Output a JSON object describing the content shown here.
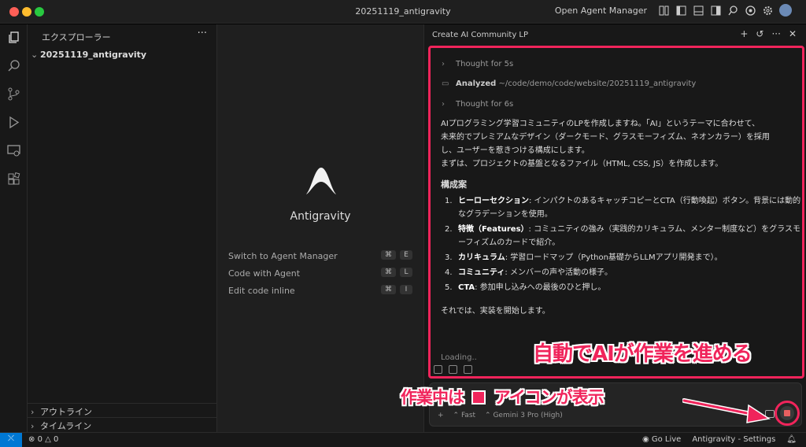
{
  "window": {
    "title": "20251119_antigravity",
    "agent_manager_label": "Open Agent Manager"
  },
  "explorer": {
    "title": "エクスプローラー",
    "more": "···",
    "folder": "20251119_antigravity",
    "outline": "アウトライン",
    "timeline": "タイムライン"
  },
  "editor": {
    "app_name": "Antigravity",
    "shortcuts": [
      {
        "label": "Switch to Agent Manager",
        "key1": "⌘",
        "key2": "E"
      },
      {
        "label": "Code with Agent",
        "key1": "⌘",
        "key2": "L"
      },
      {
        "label": "Edit code inline",
        "key1": "⌘",
        "key2": "I"
      }
    ]
  },
  "chat": {
    "title": "Create AI Community LP",
    "thought1": "Thought for 5s",
    "analyzed_label": "Analyzed",
    "analyzed_path": "~/code/demo/code/website/20251119_antigravity",
    "thought2": "Thought for 6s",
    "intro_lines": [
      "AIプログラミング学習コミュニティのLPを作成しますね。「AI」というテーマに合わせて、",
      "未来的でプレミアムなデザイン（ダークモード、グラスモーフィズム、ネオンカラー）を採用",
      "し、ユーザーを惹きつける構成にします。",
      "まずは、プロジェクトの基盤となるファイル（HTML, CSS, JS）を作成します。"
    ],
    "plan_title": "構成案",
    "plan": [
      {
        "num": "1.",
        "bold": "ヒーローセクション",
        "text": ": インパクトのあるキャッチコピーとCTA（行動喚起）ボタン。背景には動的なグラデーションを使用。"
      },
      {
        "num": "2.",
        "bold": "特徴（Features）",
        "text": ": コミュニティの強み（実践的カリキュラム、メンター制度など）をグラスモーフィズムのカードで紹介。"
      },
      {
        "num": "3.",
        "bold": "カリキュラム",
        "text": ": 学習ロードマップ（Python基礎からLLMアプリ開発まで）。"
      },
      {
        "num": "4.",
        "bold": "コミュニティ",
        "text": ": メンバーの声や活動の様子。"
      },
      {
        "num": "5.",
        "bold": "CTA",
        "text": ": 参加申し込みへの最後のひと押し。"
      }
    ],
    "closing": "それでは、実装を開始します。",
    "loading": "Loading..",
    "mode": "Fast",
    "model": "Gemini 3 Pro (High)"
  },
  "annotations": {
    "callout_auto": "自動でAIが作業を進める",
    "callout_working_a": "作業中は",
    "callout_working_b": "アイコンが表示",
    "accent": "#f0245b"
  },
  "status": {
    "errors": "0",
    "warnings": "0",
    "go_live": "Go Live",
    "settings": "Antigravity - Settings"
  }
}
